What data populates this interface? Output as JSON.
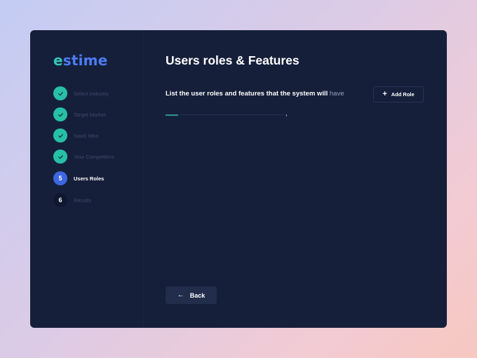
{
  "app": {
    "logo_first_letter": "e",
    "logo_rest": "stime"
  },
  "steps": [
    {
      "number": "1",
      "label": "Select Industry",
      "state": "done"
    },
    {
      "number": "2",
      "label": "Target Market",
      "state": "done"
    },
    {
      "number": "3",
      "label": "SaaS Idea",
      "state": "done"
    },
    {
      "number": "4",
      "label": "Your Competitors",
      "state": "done"
    },
    {
      "number": "5",
      "label": "Users Roles",
      "state": "active"
    },
    {
      "number": "6",
      "label": "Results",
      "state": "pending"
    }
  ],
  "main": {
    "title": "Users roles & Features",
    "subtitle": "List the user roles and features that the system will",
    "subtitle_tail": "have",
    "add_role_label": "Add Role",
    "back_label": "Back"
  },
  "colors": {
    "background_panel": "#161f3a",
    "accent_teal": "#2fc9b7",
    "accent_blue": "#3d67e0",
    "logo_blue": "#4b7cf6"
  },
  "icons": {
    "step_done": "check-icon",
    "add": "plus-icon",
    "back": "arrow-left-icon"
  }
}
